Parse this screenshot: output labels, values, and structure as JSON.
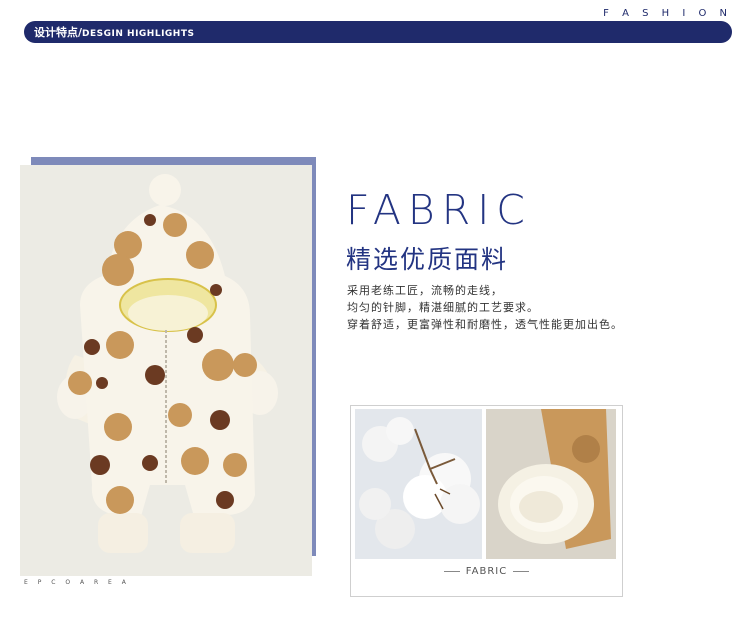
{
  "header": {
    "brand_tag": "F A S H I O N",
    "title_cn": "设计特点/",
    "title_en": "DESGIN HIGHLIGHTS"
  },
  "product_photo": {
    "corner_label": "E P C O   A R E A"
  },
  "fabric": {
    "title": "FABRIC",
    "subtitle": "精选优质面料",
    "lines": [
      "采用老练工匠，流畅的走线，",
      "均匀的针脚，精湛细腻的工艺要求。",
      "穿着舒适，更富弹性和耐磨性，透气性能更加出色。"
    ],
    "caption": "FABRIC"
  },
  "colors": {
    "navy": "#1f2a6b",
    "accent_blue": "#233482",
    "photo_frame": "#7e8aba"
  }
}
